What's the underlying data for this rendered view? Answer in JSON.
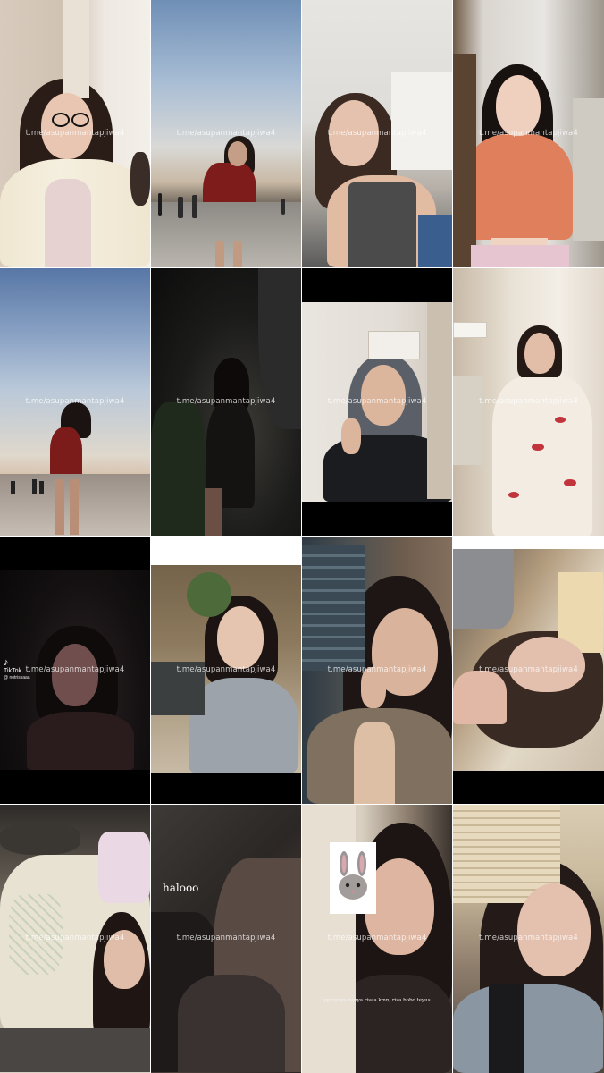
{
  "watermark": "t.me/asupanmantapjiwa4",
  "tiles": [
    {
      "id": 1,
      "scene": "indoor-glasses"
    },
    {
      "id": 2,
      "scene": "beach-red-dress"
    },
    {
      "id": 3,
      "scene": "indoor-gray-top"
    },
    {
      "id": 4,
      "scene": "indoor-orange-sweater"
    },
    {
      "id": 5,
      "scene": "beach-sky"
    },
    {
      "id": 6,
      "scene": "dark-night"
    },
    {
      "id": 7,
      "scene": "indoor-black-jacket"
    },
    {
      "id": 8,
      "scene": "room-white-tshirt"
    },
    {
      "id": 9,
      "scene": "tiktok-dark"
    },
    {
      "id": 10,
      "scene": "cafe-gray-sweater"
    },
    {
      "id": 11,
      "scene": "bar-selfie"
    },
    {
      "id": 12,
      "scene": "lying-selfie"
    },
    {
      "id": 13,
      "scene": "bed-pajamas"
    },
    {
      "id": 14,
      "scene": "halooo-dark"
    },
    {
      "id": 15,
      "scene": "sticker-selfie"
    },
    {
      "id": 16,
      "scene": "blinds-selfie"
    }
  ],
  "overlays": {
    "tiktok_logo": "TikTok",
    "tiktok_user": "@ notrissaaa",
    "halo_text": "halooo",
    "caption_text": "yg nanya nanya risaa kmn, risa bobo teyus",
    "sticker_icon": "bunny-icon"
  }
}
